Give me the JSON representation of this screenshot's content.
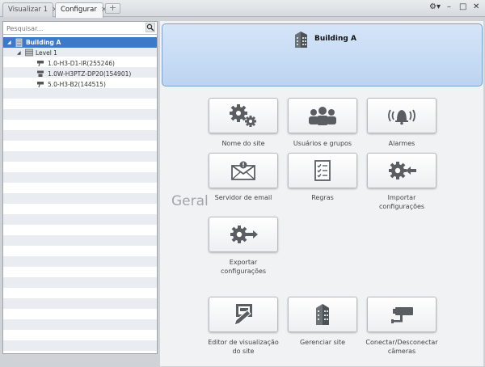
{
  "tabs": [
    {
      "label": "Visualizar 1"
    },
    {
      "label": "Configurar"
    }
  ],
  "window_controls": {
    "settings": "⚙▾",
    "minimize": "–",
    "maximize": "□",
    "close": "✕"
  },
  "sidebar": {
    "search_placeholder": "Pesquisar...",
    "tree": {
      "site": "Building A",
      "level": "Level 1",
      "cameras": [
        "1.0-H3-D1-IR(255246)",
        "1.0W-H3PTZ-DP20(154901)",
        "5.0-H3-B2(144515)"
      ]
    }
  },
  "header": {
    "title": "Building A"
  },
  "section_label": "Geral",
  "tiles": {
    "site_name": "Nome do site",
    "users_groups": "Usuários e grupos",
    "alarms": "Alarmes",
    "email_server": "Servidor de email",
    "rules": "Regras",
    "import_l1": "Importar",
    "import_l2": "configurações",
    "export_l1": "Exportar",
    "export_l2": "configurações",
    "view_editor_l1": "Editor de visualização",
    "view_editor_l2": "do site",
    "manage_site": "Gerenciar site",
    "connect_l1": "Conectar/Desconectar",
    "connect_l2": "câmeras"
  },
  "colors": {
    "selection": "#3e78c8",
    "header_bg": "#c8dcf5",
    "icon": "#555555"
  }
}
